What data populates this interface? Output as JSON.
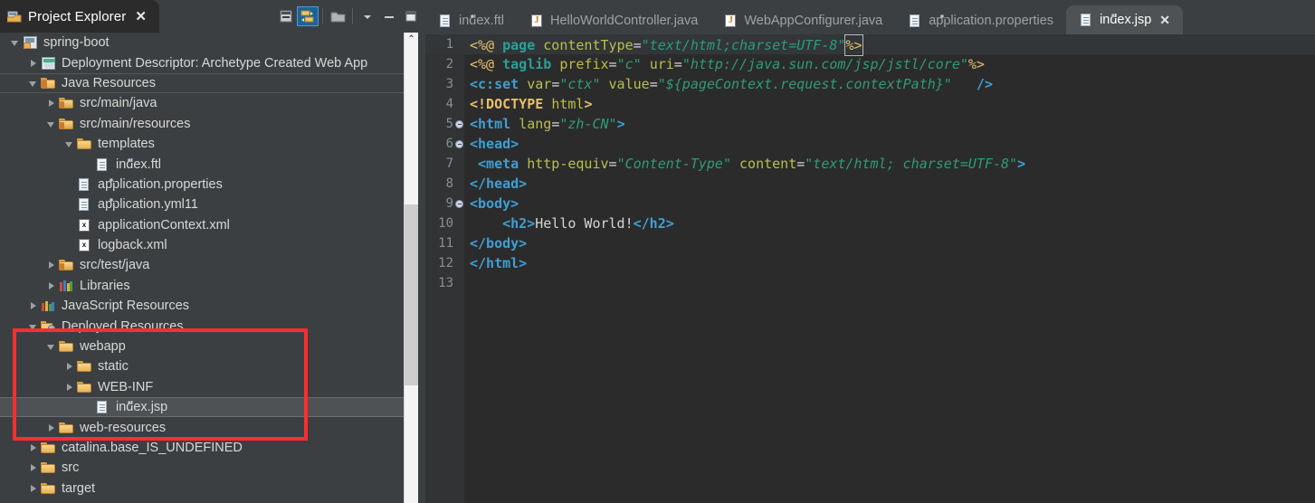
{
  "explorer": {
    "tab": {
      "title": "Project Explorer",
      "close": "✕",
      "icon": "project-explorer-icon"
    },
    "toolbar": [
      {
        "name": "collapse-all-icon",
        "selected": false
      },
      {
        "name": "link-with-editor-icon",
        "selected": true
      },
      {
        "name": "view-menu-folder-icon",
        "selected": false
      },
      {
        "name": "view-menu-chevron-icon",
        "selected": false
      },
      {
        "name": "minimize-icon",
        "selected": false
      },
      {
        "name": "maximize-icon",
        "selected": false
      }
    ],
    "tree": [
      {
        "label": "spring-boot",
        "indent": 0,
        "arrow": "down",
        "icon": "project-icon",
        "state": "normal"
      },
      {
        "label": "Deployment Descriptor: Archetype Created Web App",
        "indent": 1,
        "arrow": "right",
        "icon": "deployment-descriptor-icon",
        "state": "normal"
      },
      {
        "label": "Java Resources",
        "indent": 1,
        "arrow": "down",
        "icon": "java-resources-icon",
        "state": "outline"
      },
      {
        "label": "src/main/java",
        "indent": 2,
        "arrow": "right",
        "icon": "source-folder-icon",
        "state": "normal"
      },
      {
        "label": "src/main/resources",
        "indent": 2,
        "arrow": "down",
        "icon": "source-folder-icon",
        "state": "normal"
      },
      {
        "label": "templates",
        "indent": 3,
        "arrow": "down",
        "icon": "folder-icon",
        "state": "normal"
      },
      {
        "label": "index.ftl",
        "indent": 4,
        "arrow": "none",
        "icon": "file-icon",
        "state": "normal"
      },
      {
        "label": "application.properties",
        "indent": 3,
        "arrow": "none",
        "icon": "file-icon",
        "state": "normal"
      },
      {
        "label": "application.yml11",
        "indent": 3,
        "arrow": "none",
        "icon": "file-icon",
        "state": "normal"
      },
      {
        "label": "applicationContext.xml",
        "indent": 3,
        "arrow": "none",
        "icon": "xml-file-icon",
        "state": "normal"
      },
      {
        "label": "logback.xml",
        "indent": 3,
        "arrow": "none",
        "icon": "xml-file-icon",
        "state": "normal"
      },
      {
        "label": "src/test/java",
        "indent": 2,
        "arrow": "right",
        "icon": "source-folder-icon",
        "state": "normal"
      },
      {
        "label": "Libraries",
        "indent": 2,
        "arrow": "right",
        "icon": "libraries-icon",
        "state": "normal"
      },
      {
        "label": "JavaScript Resources",
        "indent": 1,
        "arrow": "right",
        "icon": "javascript-resources-icon",
        "state": "normal"
      },
      {
        "label": "Deployed Resources",
        "indent": 1,
        "arrow": "down",
        "icon": "deployed-resources-icon",
        "state": "normal"
      },
      {
        "label": "webapp",
        "indent": 2,
        "arrow": "down",
        "icon": "folder-icon",
        "state": "normal"
      },
      {
        "label": "static",
        "indent": 3,
        "arrow": "right",
        "icon": "folder-icon",
        "state": "normal"
      },
      {
        "label": "WEB-INF",
        "indent": 3,
        "arrow": "right",
        "icon": "folder-icon",
        "state": "normal"
      },
      {
        "label": "index.jsp",
        "indent": 4,
        "arrow": "none",
        "icon": "file-icon",
        "state": "selected"
      },
      {
        "label": "web-resources",
        "indent": 2,
        "arrow": "right",
        "icon": "folder-icon",
        "state": "normal"
      },
      {
        "label": "catalina.base_IS_UNDEFINED",
        "indent": 1,
        "arrow": "right",
        "icon": "folder-icon",
        "state": "normal"
      },
      {
        "label": "src",
        "indent": 1,
        "arrow": "right",
        "icon": "folder-icon",
        "state": "normal"
      },
      {
        "label": "target",
        "indent": 1,
        "arrow": "right",
        "icon": "folder-icon",
        "state": "normal"
      }
    ],
    "annotation": {
      "name": "red-highlight-rectangle",
      "color": "#fb2e2e"
    },
    "scrollbar": {
      "up_arrow": "⌃"
    }
  },
  "editor": {
    "tabs": [
      {
        "label": "index.ftl",
        "icon": "file-icon",
        "active": false,
        "close": ""
      },
      {
        "label": "HelloWorldController.java",
        "icon": "java-file-icon",
        "active": false,
        "close": ""
      },
      {
        "label": "WebAppConfigurer.java",
        "icon": "java-file-icon",
        "active": false,
        "close": ""
      },
      {
        "label": "application.properties",
        "icon": "file-icon",
        "active": false,
        "close": ""
      },
      {
        "label": "index.jsp",
        "icon": "file-icon",
        "active": true,
        "close": "✕"
      }
    ],
    "lines": [
      {
        "n": "1",
        "fold": false,
        "current": true
      },
      {
        "n": "2",
        "fold": false,
        "current": false
      },
      {
        "n": "3",
        "fold": false,
        "current": false
      },
      {
        "n": "4",
        "fold": false,
        "current": false
      },
      {
        "n": "5",
        "fold": true,
        "current": false
      },
      {
        "n": "6",
        "fold": true,
        "current": false
      },
      {
        "n": "7",
        "fold": false,
        "current": false
      },
      {
        "n": "8",
        "fold": false,
        "current": false
      },
      {
        "n": "9",
        "fold": true,
        "current": false
      },
      {
        "n": "10",
        "fold": false,
        "current": false
      },
      {
        "n": "11",
        "fold": false,
        "current": false
      },
      {
        "n": "12",
        "fold": false,
        "current": false
      },
      {
        "n": "13",
        "fold": false,
        "current": false
      }
    ],
    "code_text": [
      "<%@ page contentType=\"text/html;charset=UTF-8\"%>",
      "<%@ taglib prefix=\"c\" uri=\"http://java.sun.com/jsp/jstl/core\"%>",
      "<c:set var=\"ctx\" value=\"${pageContext.request.contextPath}\" />",
      "<!DOCTYPE html>",
      "<html lang=\"zh-CN\">",
      "<head>",
      " <meta http-equiv=\"Content-Type\" content=\"text/html; charset=UTF-8\">",
      "</head>",
      "<body>",
      "    <h2>Hello World!</h2>",
      "</body>",
      "</html>",
      ""
    ],
    "language": "jsp",
    "colors": {
      "background": "#2b2b2b",
      "gutter": "#313335",
      "current_line": "#323639",
      "directive": "#e8bf6a",
      "keyword": "#2aa198",
      "tag": "#3f9fd4",
      "attribute": "#bcbf4a",
      "string": "#2c9c7a",
      "text": "#d6d6d6"
    }
  }
}
